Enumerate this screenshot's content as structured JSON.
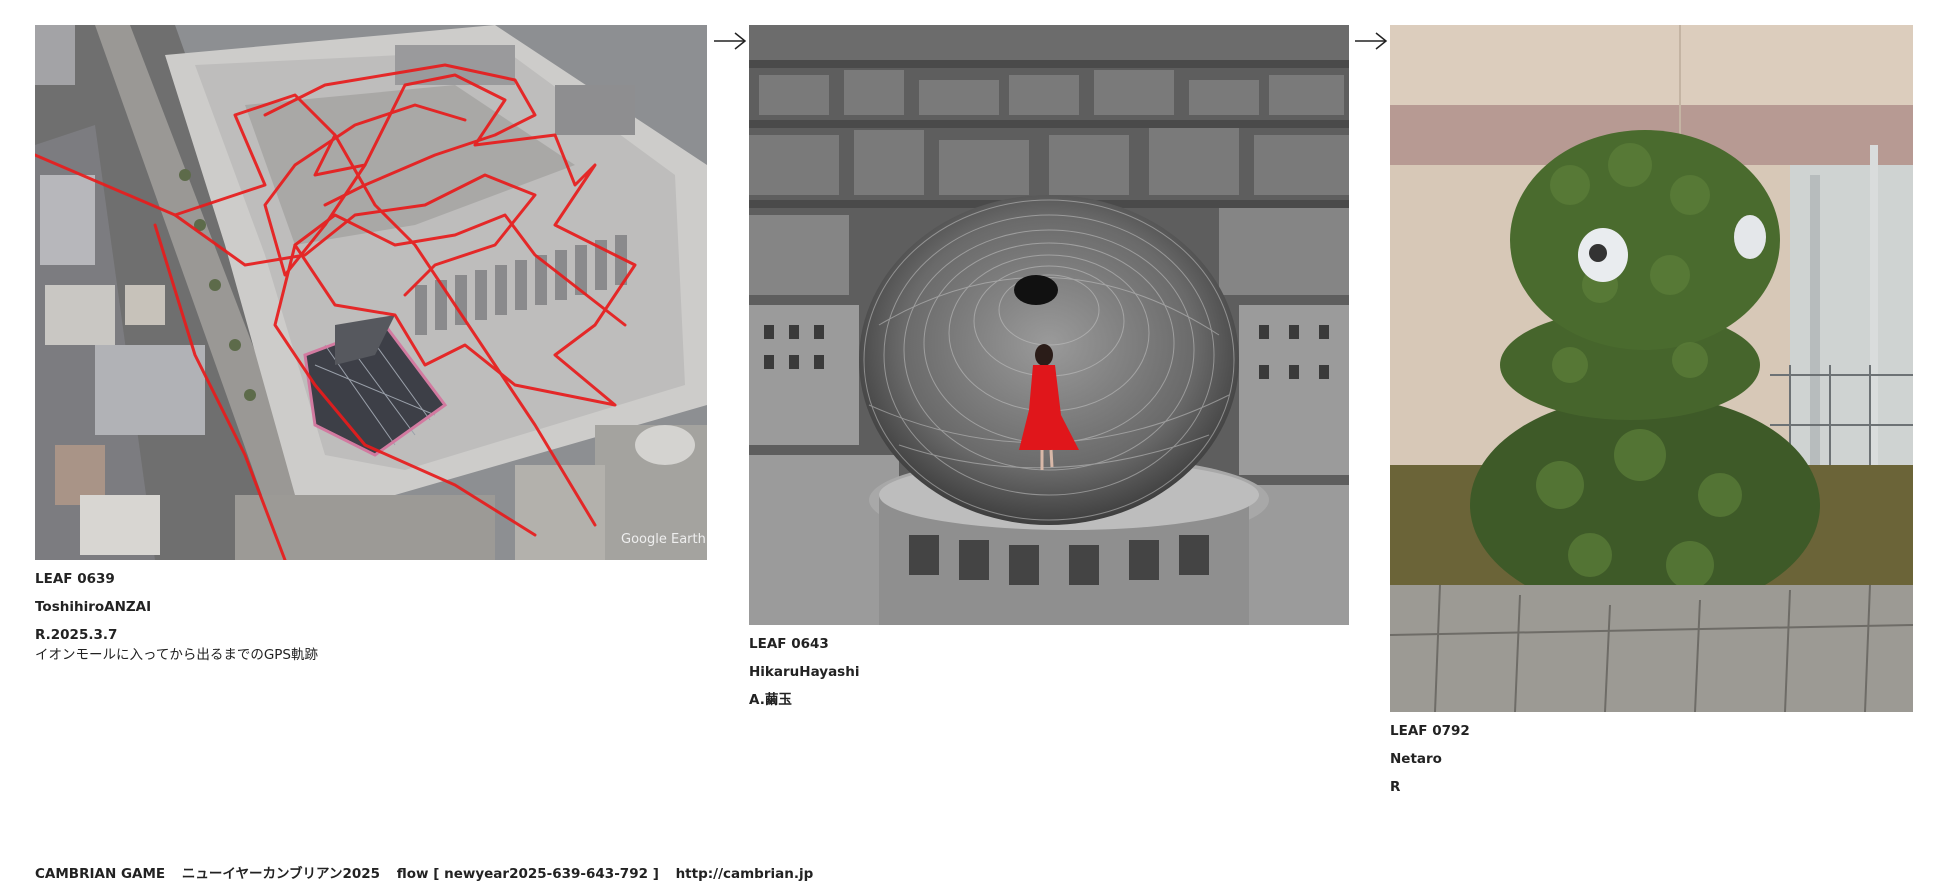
{
  "leaves": [
    {
      "id": "LEAF 0639",
      "author": "ToshihiroANZAI",
      "answer": "R.2025.3.7",
      "note": "イオンモールに入ってから出るまでのGPS軌跡",
      "image_watermark": "Google Earth"
    },
    {
      "id": "LEAF 0643",
      "author": "HikaruHayashi",
      "answer": "A.繭玉"
    },
    {
      "id": "LEAF 0792",
      "author": "Netaro",
      "answer": "R"
    }
  ],
  "arrows": [
    "right-arrow-icon",
    "right-arrow-icon"
  ],
  "footer": {
    "title": "CAMBRIAN GAME",
    "subtitle": "ニューイヤーカンブリアン2025",
    "flow": "flow [ newyear2025-639-643-792 ]",
    "url": "http://cambrian.jp"
  },
  "colors": {
    "gps_track": "#e81c1c",
    "dress": "#e0161b",
    "text": "#222222"
  }
}
